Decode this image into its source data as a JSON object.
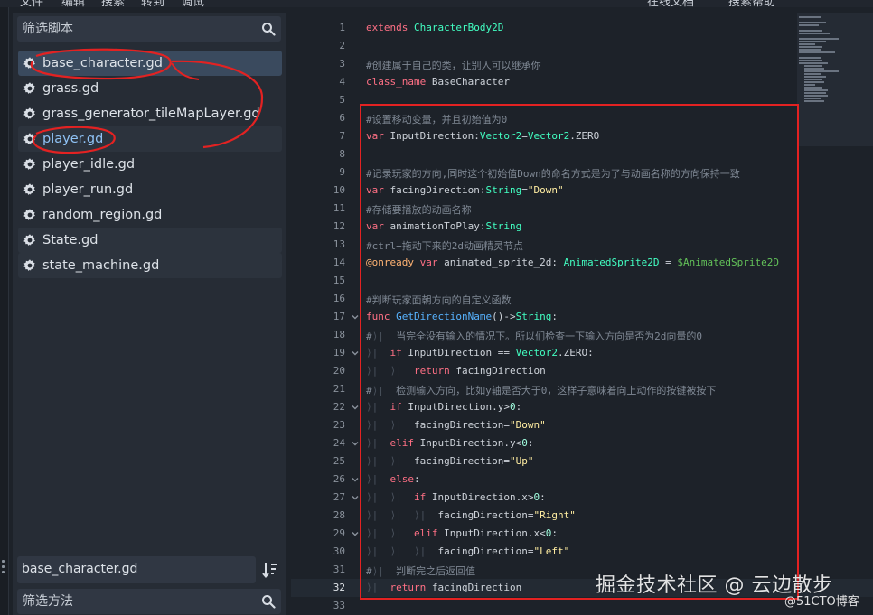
{
  "menubar": {
    "items": [
      "文件",
      "编辑",
      "搜索",
      "转到",
      "调试"
    ],
    "right_items": [
      "在线文档",
      "搜索帮助"
    ]
  },
  "script_panel": {
    "filter_placeholder": "筛选脚本",
    "scripts": [
      {
        "name": "base_character.gd",
        "selected": true
      },
      {
        "name": "grass.gd"
      },
      {
        "name": "grass_generator_tileMapLayer.gd"
      },
      {
        "name": "player.gd",
        "modified": true
      },
      {
        "name": "player_idle.gd"
      },
      {
        "name": "player_run.gd"
      },
      {
        "name": "random_region.gd"
      },
      {
        "name": "State.gd"
      },
      {
        "name": "state_machine.gd"
      }
    ],
    "current_script": "base_character.gd",
    "method_filter_placeholder": "筛选方法"
  },
  "editor": {
    "current_line": 32,
    "lines": [
      {
        "n": "1",
        "html": "<span class=\"kw\">extends</span> <span class=\"ty\">CharacterBody2D</span>"
      },
      {
        "n": "2",
        "html": ""
      },
      {
        "n": "3",
        "html": "<span class=\"cm\">#创建属于自己的类，让别人可以继承你</span>"
      },
      {
        "n": "4",
        "html": "<span class=\"kw\">class_name</span> BaseCharacter"
      },
      {
        "n": "5",
        "html": ""
      },
      {
        "n": "6",
        "html": "<span class=\"cm\">#设置移动变量，并且初始值为0</span>"
      },
      {
        "n": "7",
        "html": "<span class=\"kw\">var</span> InputDirection:<span class=\"ty\">Vector2</span>=<span class=\"ty\">Vector2</span>.ZERO"
      },
      {
        "n": "8",
        "html": ""
      },
      {
        "n": "9",
        "html": "<span class=\"cm\">#记录玩家的方向,同时这个初始值Down的命名方式是为了与动画名称的方向保持一致</span>"
      },
      {
        "n": "10",
        "html": "<span class=\"kw\">var</span> facingDirection:<span class=\"ty\">String</span>=<span class=\"str\">\"Down\"</span>"
      },
      {
        "n": "11",
        "html": "<span class=\"cm\">#存储要播放的动画名称</span>"
      },
      {
        "n": "12",
        "html": "<span class=\"kw\">var</span> animationToPlay:<span class=\"ty\">String</span>"
      },
      {
        "n": "13",
        "html": "<span class=\"cm\">#ctrl+拖动下来的2d动画精灵节点</span>"
      },
      {
        "n": "14",
        "html": "<span class=\"ann\">@onready</span> <span class=\"kw\">var</span> animated_sprite_2d: <span class=\"ty\">AnimatedSprite2D</span> = <span class=\"nd\">$AnimatedSprite2D</span>"
      },
      {
        "n": "15",
        "html": ""
      },
      {
        "n": "16",
        "html": "<span class=\"cm\">#判断玩家面朝方向的自定义函数</span>"
      },
      {
        "n": "17",
        "fold": true,
        "html": "<span class=\"kw\">func</span> <span class=\"fn\">GetDirectionName</span>()-><span class=\"ty\">String</span>:"
      },
      {
        "n": "18",
        "html": "<span class=\"cm\">#<span class=\"tabmark\">⟩|</span>  当完全没有输入的情况下。所以们检查一下输入方向是否为2d向量的0</span>"
      },
      {
        "n": "19",
        "fold": true,
        "html": "<span class=\"tabmark\">⟩|</span>  <span class=\"kw\">if</span> InputDirection == <span class=\"ty\">Vector2</span>.ZERO:"
      },
      {
        "n": "20",
        "html": "<span class=\"tabmark\">⟩|</span>  <span class=\"tabmark\">⟩|</span>  <span class=\"kw\">return</span> facingDirection"
      },
      {
        "n": "21",
        "html": "<span class=\"cm\">#<span class=\"tabmark\">⟩|</span>  检测输入方向，比如y轴是否大于0，这样子意味着向上动作的按键被按下</span>"
      },
      {
        "n": "22",
        "fold": true,
        "html": "<span class=\"tabmark\">⟩|</span>  <span class=\"kw\">if</span> InputDirection.y><span class=\"num\">0</span>:"
      },
      {
        "n": "23",
        "html": "<span class=\"tabmark\">⟩|</span>  <span class=\"tabmark\">⟩|</span>  facingDirection=<span class=\"str\">\"Down\"</span>"
      },
      {
        "n": "24",
        "fold": true,
        "html": "<span class=\"tabmark\">⟩|</span>  <span class=\"kw\">elif</span> InputDirection.y<<span class=\"num\">0</span>:"
      },
      {
        "n": "25",
        "html": "<span class=\"tabmark\">⟩|</span>  <span class=\"tabmark\">⟩|</span>  facingDirection=<span class=\"str\">\"Up\"</span>"
      },
      {
        "n": "26",
        "fold": true,
        "html": "<span class=\"tabmark\">⟩|</span>  <span class=\"kw\">else</span>:"
      },
      {
        "n": "27",
        "fold": true,
        "html": "<span class=\"tabmark\">⟩|</span>  <span class=\"tabmark\">⟩|</span>  <span class=\"kw\">if</span> InputDirection.x><span class=\"num\">0</span>:"
      },
      {
        "n": "28",
        "html": "<span class=\"tabmark\">⟩|</span>  <span class=\"tabmark\">⟩|</span>  <span class=\"tabmark\">⟩|</span>  facingDirection=<span class=\"str\">\"Right\"</span>"
      },
      {
        "n": "29",
        "fold": true,
        "html": "<span class=\"tabmark\">⟩|</span>  <span class=\"tabmark\">⟩|</span>  <span class=\"kw\">elif</span> InputDirection.x<<span class=\"num\">0</span>:"
      },
      {
        "n": "30",
        "html": "<span class=\"tabmark\">⟩|</span>  <span class=\"tabmark\">⟩|</span>  <span class=\"tabmark\">⟩|</span>  facingDirection=<span class=\"str\">\"Left\"</span>"
      },
      {
        "n": "31",
        "html": "<span class=\"cm\">#<span class=\"tabmark\">⟩|</span>  判断完之后返回值</span>"
      },
      {
        "n": "32",
        "html": "<span class=\"tabmark\">⟩|</span>  <span class=\"kw\">return</span> facingDirection"
      },
      {
        "n": "33",
        "html": ""
      }
    ]
  },
  "watermark": {
    "main": "掘金技术社区 @ 云边散步",
    "sub": "@51CTO博客"
  },
  "colors": {
    "annotation": "#e32222",
    "selected_bg": "#3a4a5e",
    "modified_text": "#8fc2f5"
  }
}
